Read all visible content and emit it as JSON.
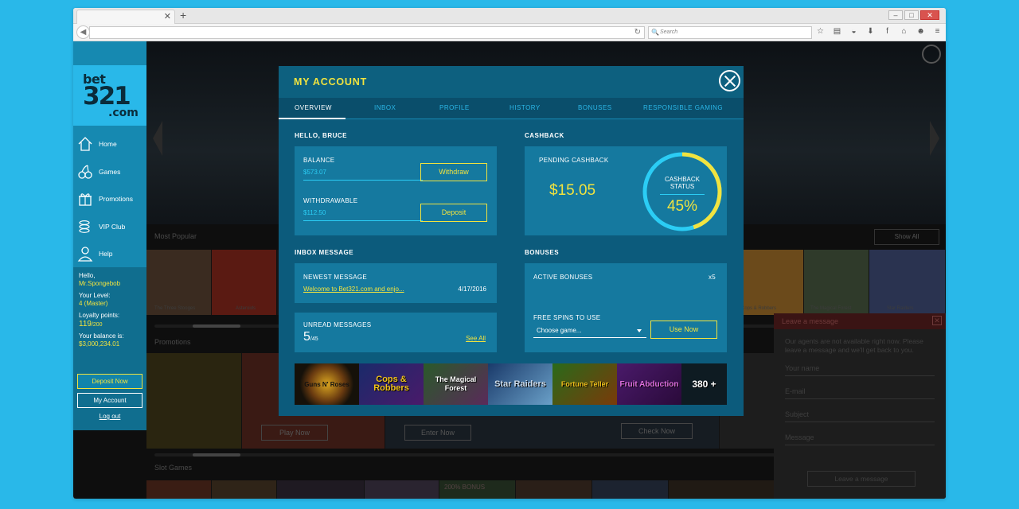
{
  "browser": {
    "search_placeholder": "Search"
  },
  "sidebar": {
    "logo": {
      "line1": "bet",
      "line2": "321",
      "line3": ".com"
    },
    "items": [
      {
        "label": "Home",
        "icon": "home-icon"
      },
      {
        "label": "Games",
        "icon": "cherries-icon"
      },
      {
        "label": "Promotions",
        "icon": "gift-icon"
      },
      {
        "label": "VIP Club",
        "icon": "coins-icon"
      },
      {
        "label": "Help",
        "icon": "person-icon"
      }
    ],
    "user": {
      "hello": "Hello,",
      "username": "Mr.Spongebob",
      "level_label": "Your Level:",
      "level_value": "4 (Master)",
      "loyalty_label": "Loyalty points:",
      "loyalty_value": "119",
      "loyalty_max": "/200",
      "balance_label": "Your balance is:",
      "balance_value": "$3,000,234.01"
    },
    "deposit_now": "Deposit Now",
    "my_account": "My Account",
    "logout": "Log out"
  },
  "background": {
    "most_popular": "Most Popular",
    "show_all": "Show All",
    "promotions": "Promotions",
    "slot_games": "Slot Games",
    "play_now": "Play Now",
    "enter_now": "Enter Now",
    "check_now": "Check Now",
    "popular_captions": [
      "The Three Stooges",
      "Asteroids",
      "Cops & Robbers",
      "The Magical Forest",
      "Star Raiders"
    ],
    "bonus_tile": "200% BONUS"
  },
  "leave_message": {
    "title": "Leave a message",
    "info": "Our agents are not available right now. Please leave a message and we'll get back to you.",
    "fields": [
      "Your name",
      "E-mail",
      "Subject",
      "Message"
    ],
    "send": "Leave a message"
  },
  "modal": {
    "title": "MY ACCOUNT",
    "tabs": [
      "OVERVIEW",
      "INBOX",
      "PROFILE",
      "HISTORY",
      "BONUSES",
      "RESPONSIBLE GAMING"
    ],
    "active_tab": "OVERVIEW",
    "hello": "HELLO, BRUCE",
    "balance_label": "BALANCE",
    "balance_value": "$573.07",
    "withdraw": "Withdraw",
    "withdrawable_label": "WITHDRAWABLE",
    "withdrawable_value": "$112.50",
    "deposit": "Deposit",
    "cashback_title": "CASHBACK",
    "pending_label": "PENDING CASHBACK",
    "pending_value": "$15.05",
    "status_line1": "CASHBACK",
    "status_line2": "STATUS",
    "status_percent": "45%",
    "status_fraction": 0.45,
    "inbox_title": "INBOX MESSAGE",
    "newest_label": "NEWEST MESSAGE",
    "newest_link": "Welcome to Bet321.com and enjo...",
    "newest_date": "4/17/2016",
    "unread_label": "UNREAD MESSAGES",
    "unread_count": "5",
    "unread_total": "/45",
    "see_all": "See All",
    "bonuses_title": "BONUSES",
    "active_bonuses": "ACTIVE BONUSES",
    "active_count": "x5",
    "free_spins": "FREE SPINS TO USE",
    "choose_game": "Choose game...",
    "use_now": "Use Now",
    "game_strip": [
      "Guns N' Roses",
      "Cops & Robbers",
      "The Magical Forest",
      "Star Raiders",
      "Fortune Teller",
      "Fruit Abduction"
    ],
    "more_games": "380 +"
  },
  "colors": {
    "accent_yellow": "#f1e33f",
    "brand_blue": "#29b8e9",
    "modal_bg": "#0c5b7c",
    "panel_bg": "#15799f",
    "light_blue": "#2bcdf5"
  }
}
